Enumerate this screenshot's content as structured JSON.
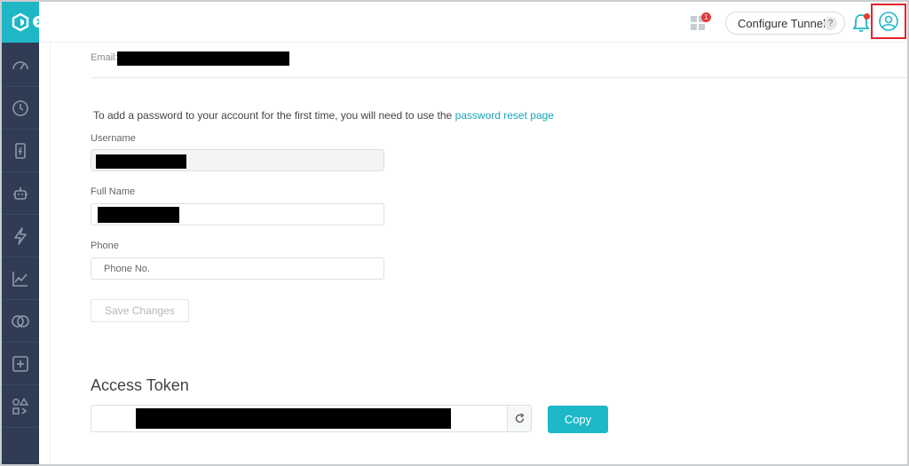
{
  "header": {
    "apps_badge": "1",
    "configure_tunnel_label": "Configure Tunnel",
    "help_glyph": "?"
  },
  "icons": {
    "logo": "logo-icon",
    "expand": "chevron-right-icon",
    "apps": "apps-grid-icon",
    "notifications": "bell-icon",
    "user": "user-icon",
    "refresh": "refresh-icon"
  },
  "sidebar": {
    "items": [
      {
        "icon": "speedometer-icon"
      },
      {
        "icon": "clock-icon"
      },
      {
        "icon": "device-icon"
      },
      {
        "icon": "robot-icon"
      },
      {
        "icon": "lightning-icon"
      },
      {
        "icon": "analytics-icon"
      },
      {
        "icon": "compare-icon"
      },
      {
        "icon": "add-box-icon"
      },
      {
        "icon": "integrations-icon"
      }
    ]
  },
  "profile": {
    "email_label": "Email:",
    "info_text_prefix": "To add a password to your account for the first time, you will need to use the ",
    "info_link": "password reset page",
    "username_label": "Username",
    "fullname_label": "Full Name",
    "phone_label": "Phone",
    "phone_placeholder": "Phone No.",
    "save_label": "Save Changes"
  },
  "access_token": {
    "title": "Access Token",
    "copy_label": "Copy"
  },
  "colors": {
    "accent": "#1eb8c9",
    "sidebar": "#2f3c54",
    "badge": "#e53935",
    "highlight": "#e0262b"
  }
}
